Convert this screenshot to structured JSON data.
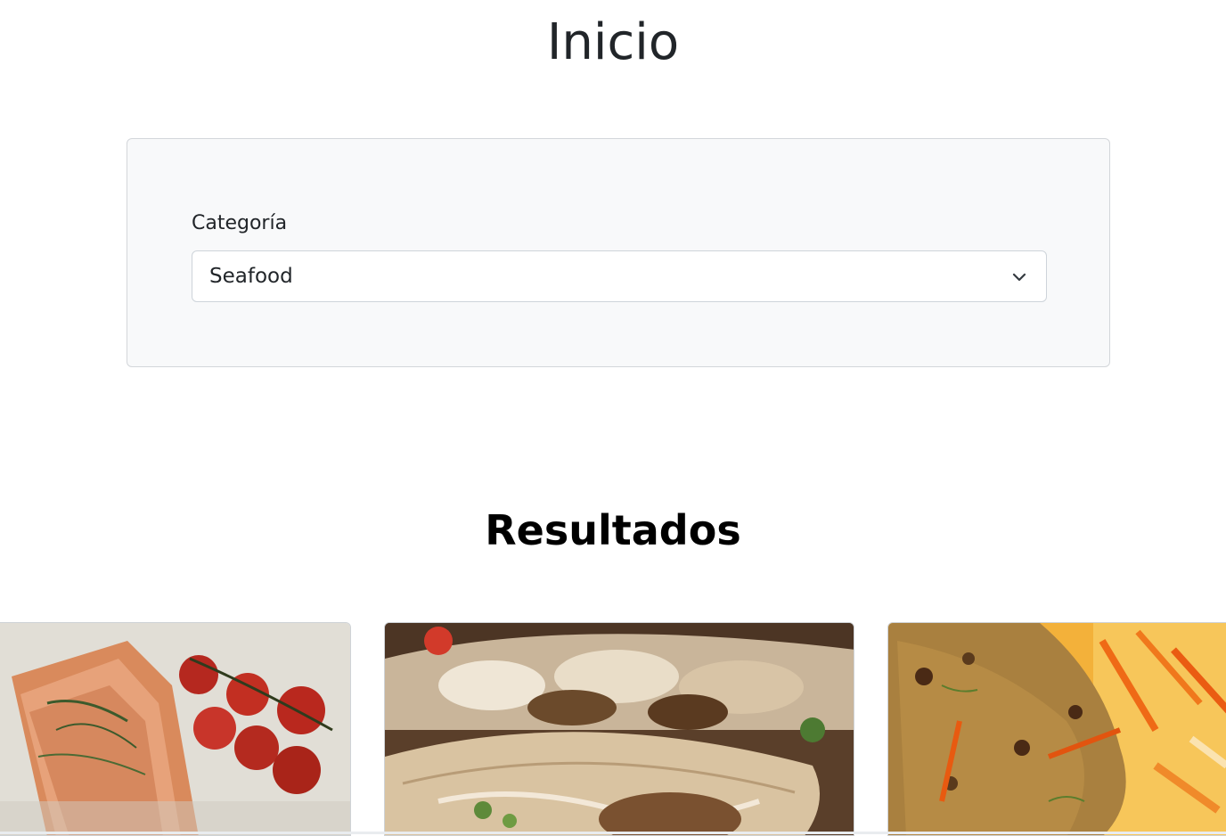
{
  "page": {
    "title": "Inicio"
  },
  "filter": {
    "category_label": "Categoría",
    "category_selected": "Seafood"
  },
  "results": {
    "title": "Resultados",
    "cards": [
      {
        "image": "baked-salmon-with-tomatoes-photo"
      },
      {
        "image": "fish-tacos-photo"
      },
      {
        "image": "fried-fish-with-peppers-photo"
      }
    ]
  }
}
